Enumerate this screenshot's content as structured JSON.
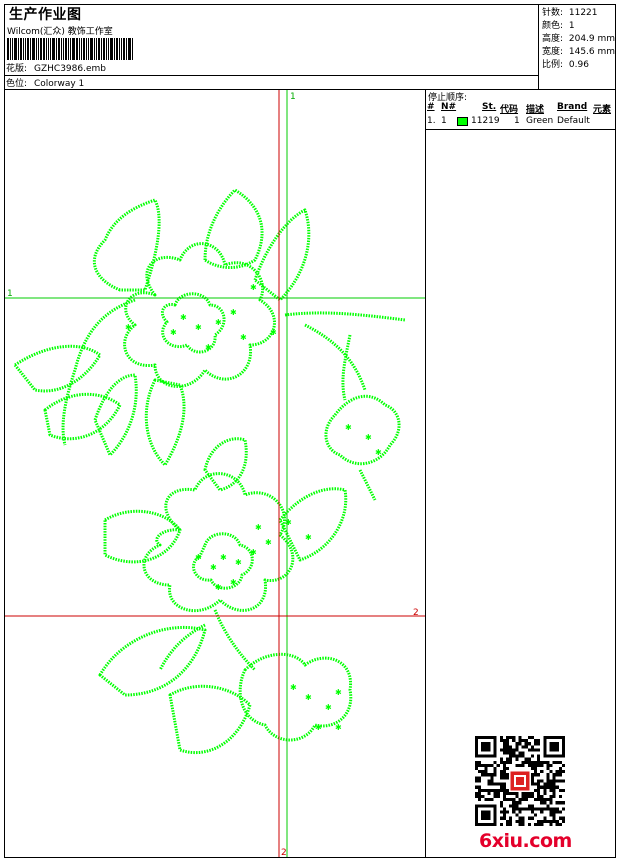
{
  "header": {
    "title": "生产作业图",
    "subtitle": "Wilcom(汇众) 教饰工作室",
    "design_label": "花版:",
    "design_file": "GZHC3986.emb",
    "colorway_label": "色位:",
    "colorway_value": "Colorway 1"
  },
  "stats": [
    {
      "label": "针数:",
      "value": "11221"
    },
    {
      "label": "颜色:",
      "value": "1"
    },
    {
      "label": "高度:",
      "value": "204.9 mm"
    },
    {
      "label": "宽度:",
      "value": "145.6 mm"
    },
    {
      "label": "比例:",
      "value": "0.96"
    }
  ],
  "stop_sequence": {
    "title": "停止顺序:",
    "headers": {
      "num": "#",
      "n": "N#",
      "st": "St.",
      "code": "代码",
      "desc": "描述",
      "brand": "Brand",
      "element": "元素"
    },
    "rows": [
      {
        "num": "1.",
        "n": "1",
        "swatch_color": "#00ff00",
        "st": "11219",
        "code": "1",
        "desc": "Green",
        "brand": "Default"
      }
    ]
  },
  "guides": {
    "v1": "1",
    "h1": "1",
    "v2": "2",
    "h2": "2"
  },
  "colors": {
    "thread": "#00ff00",
    "guide_green": "#00cc00",
    "guide_red": "#cc0000"
  },
  "watermark": "6xiu.com"
}
